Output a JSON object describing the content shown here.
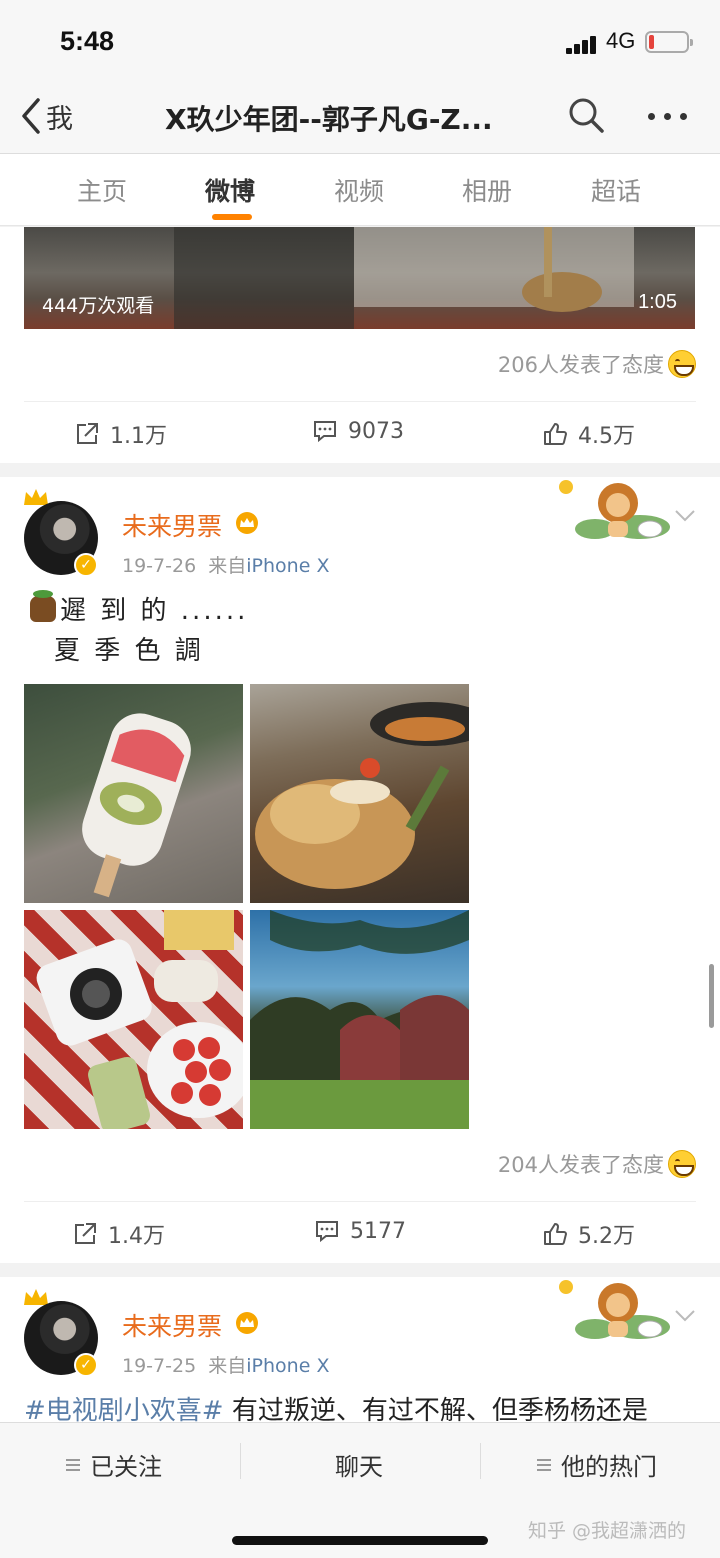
{
  "status_bar": {
    "time": "5:48",
    "network": "4G"
  },
  "nav": {
    "back_label": "我",
    "title": "X玖少年团--郭子凡G-Z..."
  },
  "tabs": [
    {
      "label": "主页",
      "active": false
    },
    {
      "label": "微博",
      "active": true
    },
    {
      "label": "视频",
      "active": false
    },
    {
      "label": "相册",
      "active": false
    },
    {
      "label": "超话",
      "active": false
    }
  ],
  "posts": [
    {
      "video": {
        "views": "444万次观看",
        "duration": "1:05"
      },
      "reactions": "206人发表了态度",
      "actions": {
        "repost": "1.1万",
        "comment": "9073",
        "like": "4.5万"
      }
    },
    {
      "author": "未来男票",
      "date": "19-7-26",
      "source_prefix": "来自",
      "source": "iPhone X",
      "text_line1": "遲 到 的 ......",
      "text_line2": "夏 季 色 調",
      "reactions": "204人发表了态度",
      "actions": {
        "repost": "1.4万",
        "comment": "5177",
        "like": "5.2万"
      }
    },
    {
      "author": "未来男票",
      "date": "19-7-25",
      "source_prefix": "来自",
      "source": "iPhone X",
      "hashtag": "#电视剧小欢喜#",
      "text": " 有过叛逆、有过不解、但季杨杨还是"
    }
  ],
  "bottom_bar": {
    "follow": "已关注",
    "chat": "聊天",
    "hot": "他的热门"
  },
  "watermark": "知乎 @我超潇洒的",
  "colors": {
    "accent": "#ff8200",
    "username": "#e86b1c",
    "link": "#5a7ea8"
  }
}
